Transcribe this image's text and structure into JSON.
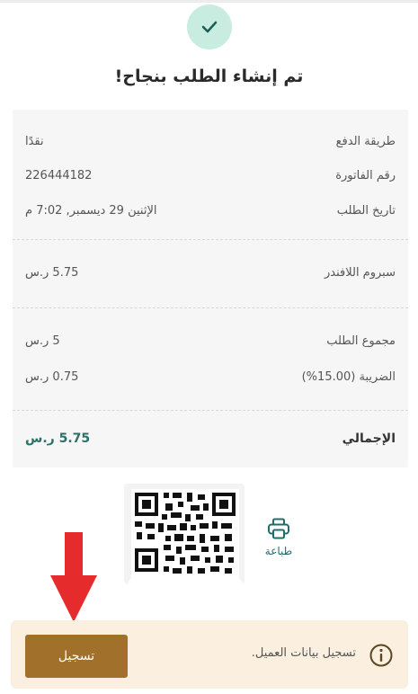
{
  "status": {
    "title": "تم إنشاء الطلب بنجاح!"
  },
  "order_info": {
    "payment_method_label": "طريقة الدفع",
    "payment_method_value": "نقدًا",
    "invoice_number_label": "رقم الفاتورة",
    "invoice_number_value": "226444182",
    "order_date_label": "تاريخ الطلب",
    "order_date_value": "الإثنين 29 ديسمبر, 7:02 م"
  },
  "items": [
    {
      "name": "سبروم اللافندر",
      "price": "5.75 ر.س"
    }
  ],
  "summary": {
    "subtotal_label": "مجموع الطلب",
    "subtotal_value": "5 ر.س",
    "tax_label": "الضريبة (15.00%)",
    "tax_value": "0.75 ر.س",
    "total_label": "الإجمالي",
    "total_value": "5.75 ر.س"
  },
  "actions": {
    "print_label": "طباعة"
  },
  "customer_banner": {
    "text": "تسجيل بيانات العميل.",
    "button_label": "تسجيل"
  },
  "colors": {
    "accent_teal": "#2d6f6a",
    "success_circle": "#c8ecdf",
    "register_button": "#a1712b",
    "banner_bg": "#fbefdf",
    "annotation_arrow": "#e52b2b"
  },
  "icons": {
    "success": "check-icon",
    "print": "printer-icon",
    "info": "info-icon",
    "qr": "qr-code"
  }
}
